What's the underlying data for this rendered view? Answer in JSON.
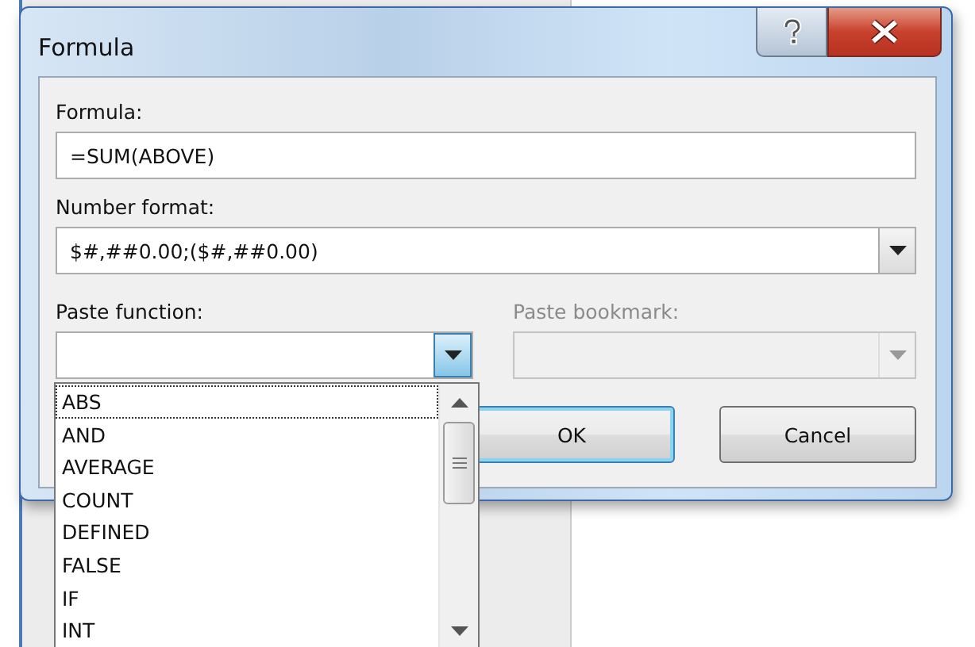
{
  "window": {
    "title": "Formula"
  },
  "formula": {
    "label": "Formula:",
    "value": "=SUM(ABOVE)"
  },
  "number_format": {
    "label": "Number format:",
    "value": "$#,##0.00;($#,##0.00)"
  },
  "paste_function": {
    "label": "Paste function:",
    "expanded": true
  },
  "paste_bookmark": {
    "label": "Paste bookmark:",
    "disabled": true
  },
  "buttons": [
    {
      "label": "OK",
      "default": true
    },
    {
      "label": "Cancel",
      "default": false
    }
  ],
  "function_list": [
    {
      "label": "ABS",
      "focused": true
    },
    {
      "label": "AND",
      "focused": false
    },
    {
      "label": "AVERAGE",
      "focused": false
    },
    {
      "label": "COUNT",
      "focused": false
    },
    {
      "label": "DEFINED",
      "focused": false
    },
    {
      "label": "FALSE",
      "focused": false
    },
    {
      "label": "IF",
      "focused": false
    },
    {
      "label": "INT",
      "focused": false
    }
  ]
}
